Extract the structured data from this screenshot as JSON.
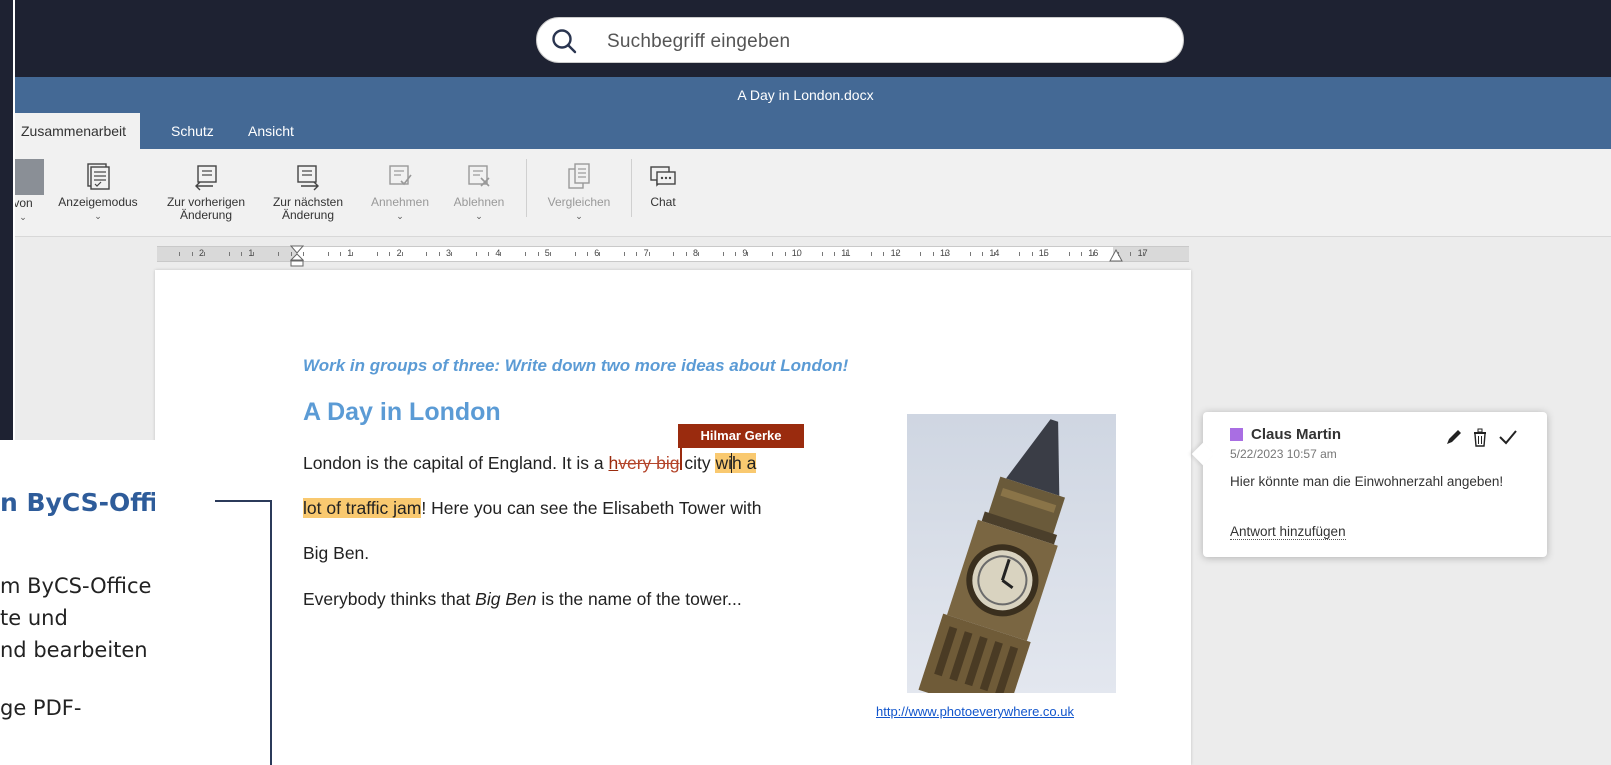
{
  "search": {
    "placeholder": "Suchbegriff eingeben"
  },
  "title": {
    "document": "A Day in London.docx"
  },
  "tabs": [
    {
      "label": "Zusammenarbeit",
      "active": true
    },
    {
      "label": "Schutz"
    },
    {
      "label": "Ansicht"
    }
  ],
  "ribbon": {
    "von": "von",
    "anzeigemodus": "Anzeigemodus",
    "prev_line1": "Zur vorherigen",
    "prev_line2": "Änderung",
    "next_line1": "Zur nächsten",
    "next_line2": "Änderung",
    "annehmen": "Annehmen",
    "ablehnen": "Ablehnen",
    "vergleichen": "Vergleichen",
    "chat": "Chat"
  },
  "ruler": {
    "labels": [
      "2",
      "1",
      "",
      "1",
      "2",
      "3",
      "4",
      "5",
      "6",
      "7",
      "8",
      "9",
      "10",
      "11",
      "12",
      "13",
      "14",
      "15",
      "16",
      "17"
    ]
  },
  "document": {
    "task": "Work in groups of three: Write down two more ideas about London!",
    "heading": "A Day in London",
    "p1_a": "London is the capital of England. It is a ",
    "p1_ins": "h",
    "p1_del": "very big",
    "p1_b": " city ",
    "p1_hl1": "wi",
    "p1_hl2": "h a",
    "p2_hl": "lot of traffic jam",
    "p2_b": "! Here you can see the Elisabeth Tower with",
    "p3": "Big Ben.",
    "p4_a": "Everybody thinks that ",
    "p4_em": "Big Ben",
    "p4_b": " is the name of the tower...",
    "flag_author": "Hilmar Gerke",
    "photo_link": "http://www.photoeverywhere.co.uk"
  },
  "comment": {
    "author": "Claus Martin",
    "time": "5/22/2023 10:57 am",
    "text": "Hier könnte man die Einwohnerzahl angeben!",
    "reply": "Antwort hinzufügen",
    "author_color": "#a96ee3"
  },
  "slide": {
    "title": "n ByCS-Office",
    "line1": "m ByCS-Office direkt",
    "line2": "te  und",
    "line3": "nd bearbeiten",
    "line4": "ge PDF-"
  },
  "colors": {
    "topbar": "#1e2232",
    "header_blue": "#446995",
    "accent_blue": "#5b9bd5",
    "change_red": "#9a2b0e",
    "highlight": "#f9c970"
  },
  "icons": [
    "search-icon",
    "display-mode-icon",
    "prev-change-icon",
    "next-change-icon",
    "accept-icon",
    "reject-icon",
    "compare-icon",
    "chat-icon",
    "edit-icon",
    "delete-icon",
    "resolve-icon"
  ]
}
